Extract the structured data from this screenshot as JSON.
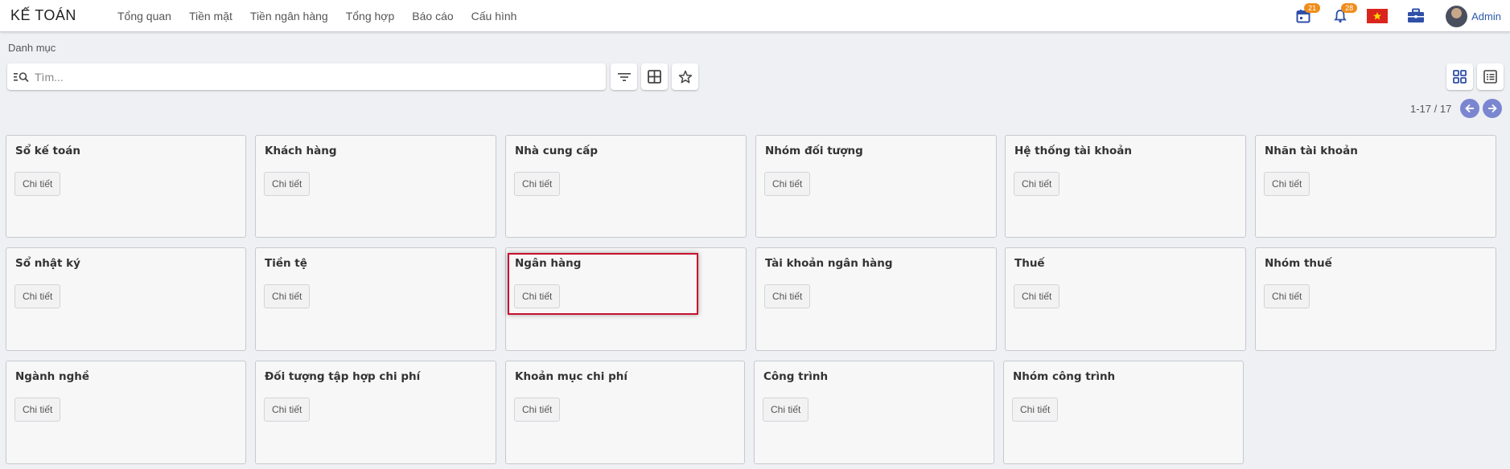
{
  "app": {
    "title": "KẾ TOÁN"
  },
  "menu": {
    "items": [
      {
        "label": "Tổng quan"
      },
      {
        "label": "Tiền mặt"
      },
      {
        "label": "Tiền ngân hàng"
      },
      {
        "label": "Tổng hợp"
      },
      {
        "label": "Báo cáo"
      },
      {
        "label": "Cấu hình"
      }
    ]
  },
  "nav": {
    "calendar_badge": "21",
    "bell_badge": "28",
    "user_name": "Admin",
    "accent_badge_color": "#f08c1a",
    "flag": "vietnam-flag-icon"
  },
  "breadcrumb": "Danh mục",
  "search": {
    "placeholder": "Tìm..."
  },
  "pager": {
    "text": "1-17 / 17"
  },
  "cards": [
    {
      "title": "Sổ kế toán",
      "button": "Chi tiết"
    },
    {
      "title": "Khách hàng",
      "button": "Chi tiết"
    },
    {
      "title": "Nhà cung cấp",
      "button": "Chi tiết"
    },
    {
      "title": "Nhóm đối tượng",
      "button": "Chi tiết"
    },
    {
      "title": "Hệ thống tài khoản",
      "button": "Chi tiết"
    },
    {
      "title": "Nhãn tài khoản",
      "button": "Chi tiết"
    },
    {
      "title": "Sổ nhật ký",
      "button": "Chi tiết"
    },
    {
      "title": "Tiền tệ",
      "button": "Chi tiết"
    },
    {
      "title": "Ngân hàng",
      "button": "Chi tiết"
    },
    {
      "title": "Tài khoản ngân hàng",
      "button": "Chi tiết"
    },
    {
      "title": "Thuế",
      "button": "Chi tiết"
    },
    {
      "title": "Nhóm thuế",
      "button": "Chi tiết"
    },
    {
      "title": "Ngành nghề",
      "button": "Chi tiết"
    },
    {
      "title": "Đối tượng tập hợp chi phí",
      "button": "Chi tiết"
    },
    {
      "title": "Khoản mục chi phí",
      "button": "Chi tiết"
    },
    {
      "title": "Công trình",
      "button": "Chi tiết"
    },
    {
      "title": "Nhóm công trình",
      "button": "Chi tiết"
    }
  ],
  "colors": {
    "highlight": "#c8102e",
    "pager": "#7b86d1",
    "view_icon": "#2f4fa8"
  }
}
